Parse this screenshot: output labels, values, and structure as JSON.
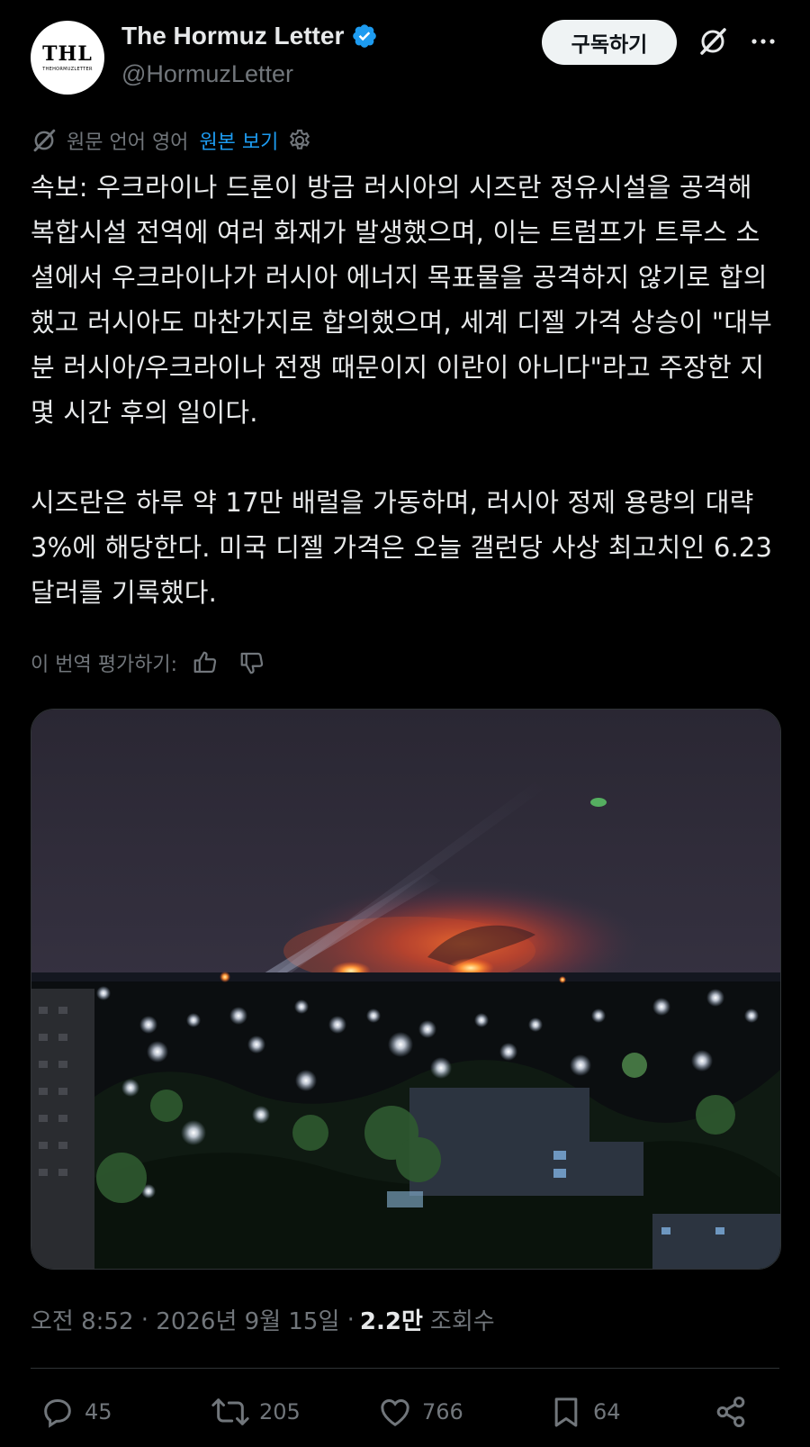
{
  "author": {
    "avatar_text": "THL",
    "avatar_subtext": "THEHORMUZLETTER",
    "name": "The Hormuz Letter",
    "handle": "@HormuzLetter"
  },
  "header": {
    "subscribe_label": "구독하기"
  },
  "translation": {
    "source_label": "원문 언어 영어",
    "show_original": "원본 보기"
  },
  "post": {
    "paragraph1": "속보: 우크라이나 드론이 방금 러시아의 시즈란 정유시설을 공격해 복합시설 전역에 여러 화재가 발생했으며, 이는 트럼프가 트루스 소셜에서 우크라이나가 러시아 에너지 목표물을 공격하지 않기로 합의했고 러시아도 마찬가지로 합의했으며, 세계 디젤 가격 상승이 \"대부분 러시아/우크라이나 전쟁 때문이지 이란이 아니다\"라고 주장한 지 몇 시간 후의 일이다.",
    "paragraph2": "시즈란은 하루 약 17만 배럴을 가동하며, 러시아 정제 용량의 대략 3%에 해당한다. 미국 디젤 가격은 오늘 갤런당 사상 최고치인 6.23달러를 기록했다.",
    "rate_label": "이 번역 평가하기:"
  },
  "meta": {
    "time": "오전 8:52",
    "date": "2026년 9월 15일",
    "views": "2.2만",
    "views_label": "조회수"
  },
  "actions": {
    "replies": "45",
    "reposts": "205",
    "likes": "766",
    "bookmarks": "64"
  },
  "colors": {
    "accent": "#1d9bf0",
    "background": "#000000",
    "muted": "#71767b"
  }
}
